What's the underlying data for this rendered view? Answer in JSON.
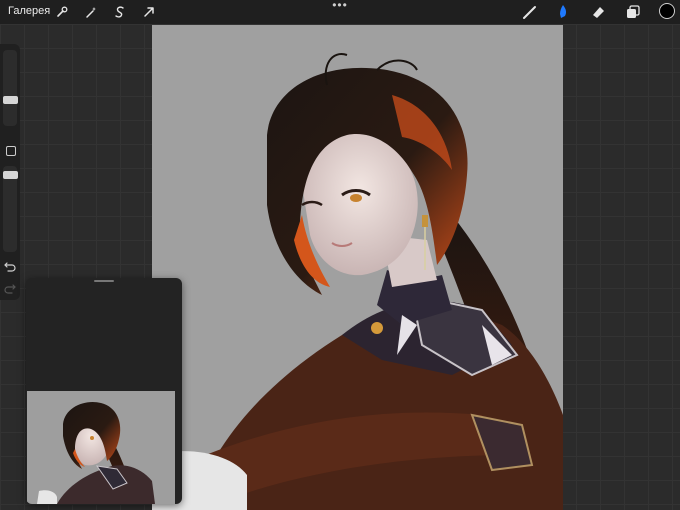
{
  "topbar": {
    "gallery_label": "Галерея",
    "left_tools": [
      "wrench-icon",
      "magic-wand-icon",
      "selection-s-icon",
      "transform-arrow-icon"
    ],
    "more_label": "•••",
    "right_tools": [
      "brush-icon",
      "smudge-icon",
      "eraser-icon",
      "layers-icon"
    ],
    "active_tool": "smudge-icon",
    "active_color": "#1f7aff",
    "current_color": "#000000"
  },
  "sidebar": {
    "controls": [
      "brush-size-slider",
      "modify-square-button",
      "opacity-slider",
      "undo-icon",
      "redo-icon"
    ]
  },
  "canvas": {
    "background": "#a0a0a0",
    "content": "illustration"
  },
  "reference": {
    "title": ""
  }
}
